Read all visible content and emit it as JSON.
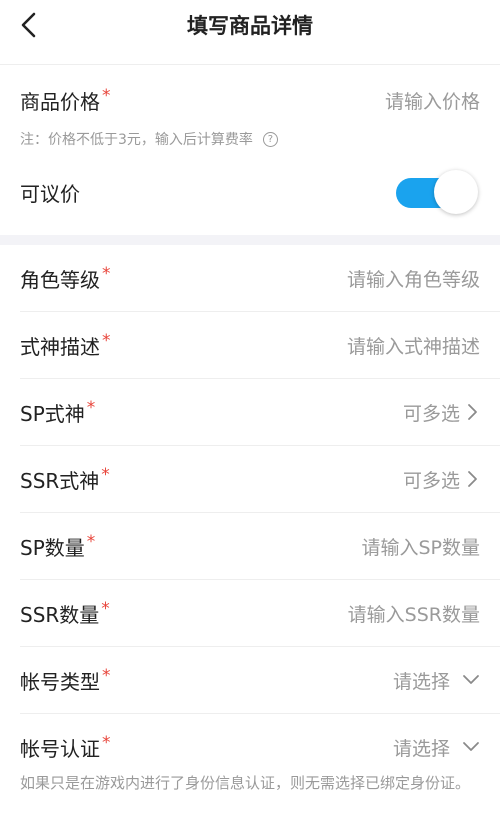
{
  "header": {
    "title": "填写商品详情"
  },
  "price": {
    "label": "商品价格",
    "required": "*",
    "placeholder": "请输入价格",
    "note": "注：价格不低于3元，输入后计算费率",
    "help_glyph": "?"
  },
  "negotiable": {
    "label": "可议价",
    "enabled": true,
    "accent": "#1aa3ee"
  },
  "fields": [
    {
      "label": "角色等级",
      "required": "*",
      "value": "请输入角色等级",
      "kind": "input"
    },
    {
      "label": "式神描述",
      "required": "*",
      "value": "请输入式神描述",
      "kind": "input"
    },
    {
      "label": "SP式神",
      "required": "*",
      "value": "可多选",
      "kind": "multi"
    },
    {
      "label": "SSR式神",
      "required": "*",
      "value": "可多选",
      "kind": "multi"
    },
    {
      "label": "SP数量",
      "required": "*",
      "value": "请输入SP数量",
      "kind": "input"
    },
    {
      "label": "SSR数量",
      "required": "*",
      "value": "请输入SSR数量",
      "kind": "input"
    },
    {
      "label": "帐号类型",
      "required": "*",
      "value": "请选择",
      "kind": "select"
    },
    {
      "label": "帐号认证",
      "required": "*",
      "value": "请选择",
      "kind": "select"
    }
  ],
  "footnote": "如果只是在游戏内进行了身份信息认证，则无需选择已绑定身份证。",
  "colors": {
    "required": "#e8443a",
    "placeholder": "#9a9a9a",
    "section_gap": "#f3f3f7"
  }
}
